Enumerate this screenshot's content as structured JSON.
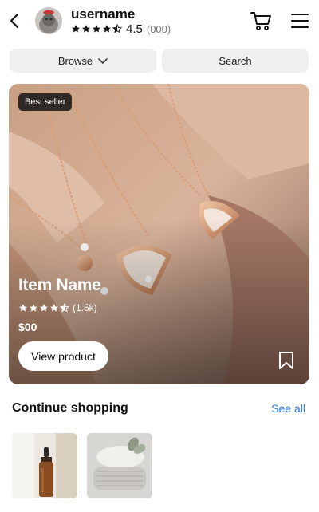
{
  "header": {
    "username": "username",
    "rating_value": "4.5",
    "rating_count": "(000)",
    "stars_filled": 4.5,
    "icons": [
      "back-arrow-icon",
      "cart-icon",
      "hamburger-menu-icon"
    ]
  },
  "nav": {
    "browse_label": "Browse",
    "search_label": "Search"
  },
  "hero": {
    "badge": "Best seller",
    "item_name": "Item Name",
    "rating_count": "(1.5k)",
    "stars_filled": 4.5,
    "price": "$00",
    "view_button": "View product"
  },
  "continue_shopping": {
    "title": "Continue shopping",
    "see_all": "See all"
  },
  "colors": {
    "link": "#2f7de1",
    "pill_bg": "#efefef",
    "badge_bg": "#141414"
  }
}
